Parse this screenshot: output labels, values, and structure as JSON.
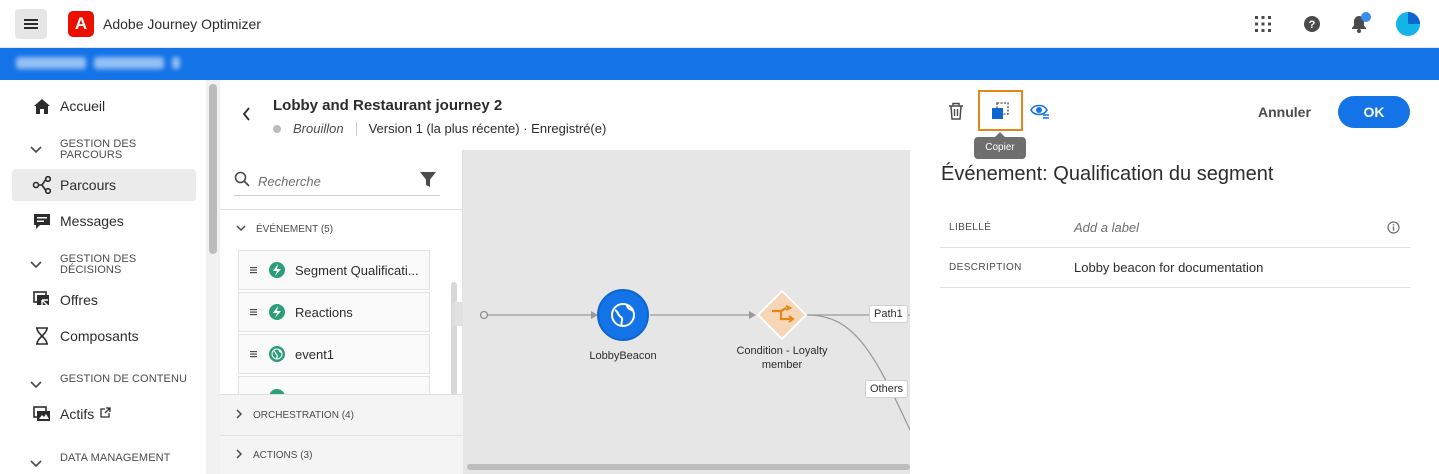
{
  "app": {
    "title": "Adobe Journey Optimizer",
    "logo_letter": "A",
    "brand_color": "#eb1000",
    "accent_color": "#1473e6"
  },
  "topbar": {
    "icons": [
      "apps-grid-icon",
      "help-icon",
      "notifications-icon",
      "avatar"
    ]
  },
  "nav": {
    "home": "Accueil",
    "section_journeys": "Gestion des parcours",
    "journeys": "Parcours",
    "messages": "Messages",
    "section_decisions": "Gestion des décisions",
    "offers": "Offres",
    "components": "Composants",
    "section_content": "Gestion de contenu",
    "assets": "Actifs",
    "section_data": "Data management"
  },
  "journey": {
    "title": "Lobby and Restaurant journey 2",
    "status": "Brouillon",
    "version": "Version 1 (la plus récente) · Enregistré(e)"
  },
  "palette": {
    "search_placeholder": "Recherche",
    "events_header": "Événement (5)",
    "events": [
      {
        "label": "Segment Qualificati...",
        "icon": "segment-event-icon"
      },
      {
        "label": "Reactions",
        "icon": "reaction-event-icon"
      },
      {
        "label": "event1",
        "icon": "globe-event-icon"
      }
    ],
    "orchestration_header": "Orchestration (4)",
    "actions_header": "Actions (3)"
  },
  "canvas": {
    "node1_label": "LobbyBeacon",
    "node2_label": "Condition - Loyalty member",
    "path1": "Path1",
    "others": "Others"
  },
  "panel": {
    "copy_tooltip": "Copier",
    "cancel": "Annuler",
    "ok": "OK",
    "title": "Événement: Qualification du segment",
    "label_key": "Libellé",
    "label_placeholder": "Add a label",
    "description_key": "Description",
    "description_value": "Lobby beacon for documentation"
  }
}
